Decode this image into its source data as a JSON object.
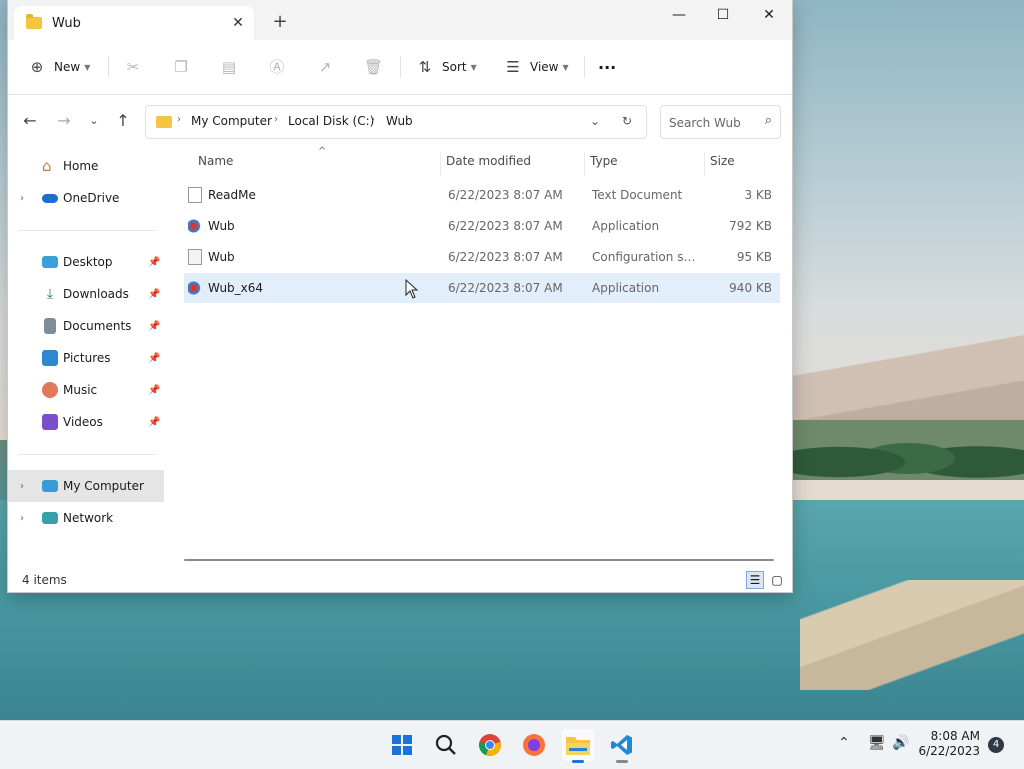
{
  "window": {
    "tab_title": "Wub",
    "new_tab": "+",
    "minimize": "—",
    "maximize": "☐",
    "close": "✕"
  },
  "toolbar": {
    "new_label": "New",
    "sort_label": "Sort",
    "view_label": "View",
    "more_label": "···"
  },
  "address": {
    "crumbs": [
      "My Computer",
      "Local Disk (C:)",
      "Wub"
    ],
    "search_placeholder": "Search Wub"
  },
  "sidebar": {
    "items": [
      {
        "label": "Home"
      },
      {
        "label": "OneDrive"
      },
      {
        "label": "Desktop"
      },
      {
        "label": "Downloads"
      },
      {
        "label": "Documents"
      },
      {
        "label": "Pictures"
      },
      {
        "label": "Music"
      },
      {
        "label": "Videos"
      },
      {
        "label": "My Computer"
      },
      {
        "label": "Network"
      }
    ]
  },
  "columns": {
    "name": "Name",
    "date": "Date modified",
    "type": "Type",
    "size": "Size"
  },
  "files": [
    {
      "name": "ReadMe",
      "date": "6/22/2023 8:07 AM",
      "type": "Text Document",
      "size": "3 KB"
    },
    {
      "name": "Wub",
      "date": "6/22/2023 8:07 AM",
      "type": "Application",
      "size": "792 KB"
    },
    {
      "name": "Wub",
      "date": "6/22/2023 8:07 AM",
      "type": "Configuration sett...",
      "size": "95 KB"
    },
    {
      "name": "Wub_x64",
      "date": "6/22/2023 8:07 AM",
      "type": "Application",
      "size": "940 KB"
    }
  ],
  "status": {
    "item_count": "4 items"
  },
  "taskbar": {
    "time": "8:08 AM",
    "date": "6/22/2023",
    "notifications": "4"
  }
}
